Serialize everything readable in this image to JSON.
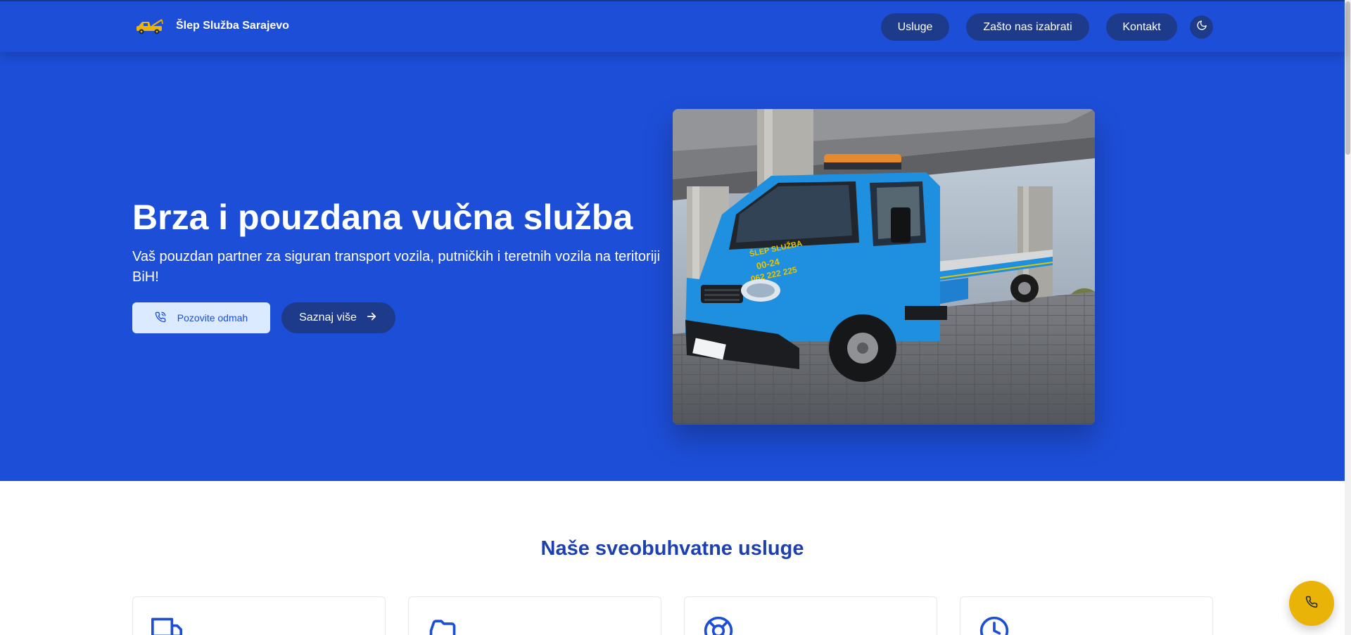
{
  "brand": {
    "name": "Šlep Služba Sarajevo",
    "icon": "tow-truck-icon"
  },
  "nav": {
    "items": [
      {
        "label": "Usluge"
      },
      {
        "label": "Zašto nas izabrati"
      },
      {
        "label": "Kontakt"
      }
    ],
    "theme_toggle_icon": "moon-icon"
  },
  "hero": {
    "title": "Brza i pouzdana vučna služba",
    "subtitle": "Vaš pouzdan partner za siguran transport vozila, putničkih i teretnih vozila na teritoriji BiH!",
    "primary_button": {
      "label": "Pozovite odmah",
      "icon": "phone-icon"
    },
    "secondary_button": {
      "label": "Saznaj više",
      "icon": "arrow-right-icon"
    },
    "image": {
      "icon": "tow-truck-photo",
      "truck_text": [
        "ŠLEP SLUŽBA",
        "00-24",
        "062 222 225"
      ]
    }
  },
  "services": {
    "title": "Naše sveobuhvatne usluge",
    "cards": [
      {
        "icon": "truck-icon"
      },
      {
        "icon": "car-icon"
      },
      {
        "icon": "lifebuoy-icon"
      },
      {
        "icon": "clock-icon"
      }
    ]
  },
  "fab": {
    "icon": "phone-icon"
  },
  "colors": {
    "primary": "#1d4ed8",
    "dark": "#1e3a8a",
    "accent": "#eab308",
    "light": "#dbeafe",
    "heading": "#1e40af"
  }
}
